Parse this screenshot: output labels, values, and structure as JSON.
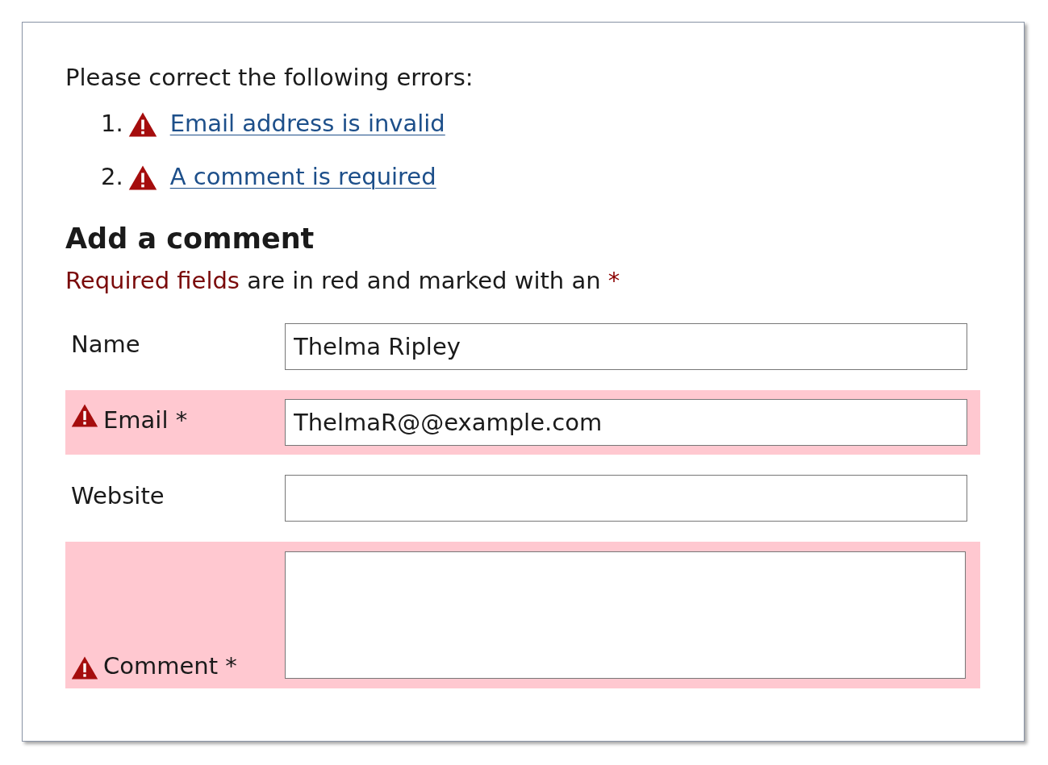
{
  "error_summary": {
    "title": "Please correct the following errors:",
    "errors": [
      {
        "number": "1.",
        "text": "Email address is invalid"
      },
      {
        "number": "2.",
        "text": "A comment is required"
      }
    ]
  },
  "form": {
    "heading": "Add a comment",
    "required_note": {
      "highlight": "Required fields",
      "text": "are in red and marked with an",
      "marker": "*"
    },
    "fields": [
      {
        "kind": "input",
        "label": "Name",
        "value": "Thelma Ripley",
        "error": false
      },
      {
        "kind": "input",
        "label": "Email",
        "marker": "*",
        "value": "ThelmaR@@example.com",
        "error": true
      },
      {
        "kind": "input",
        "label": "Website",
        "error": false
      },
      {
        "kind": "textarea",
        "label": "Comment",
        "marker": "*",
        "error": true
      }
    ]
  }
}
